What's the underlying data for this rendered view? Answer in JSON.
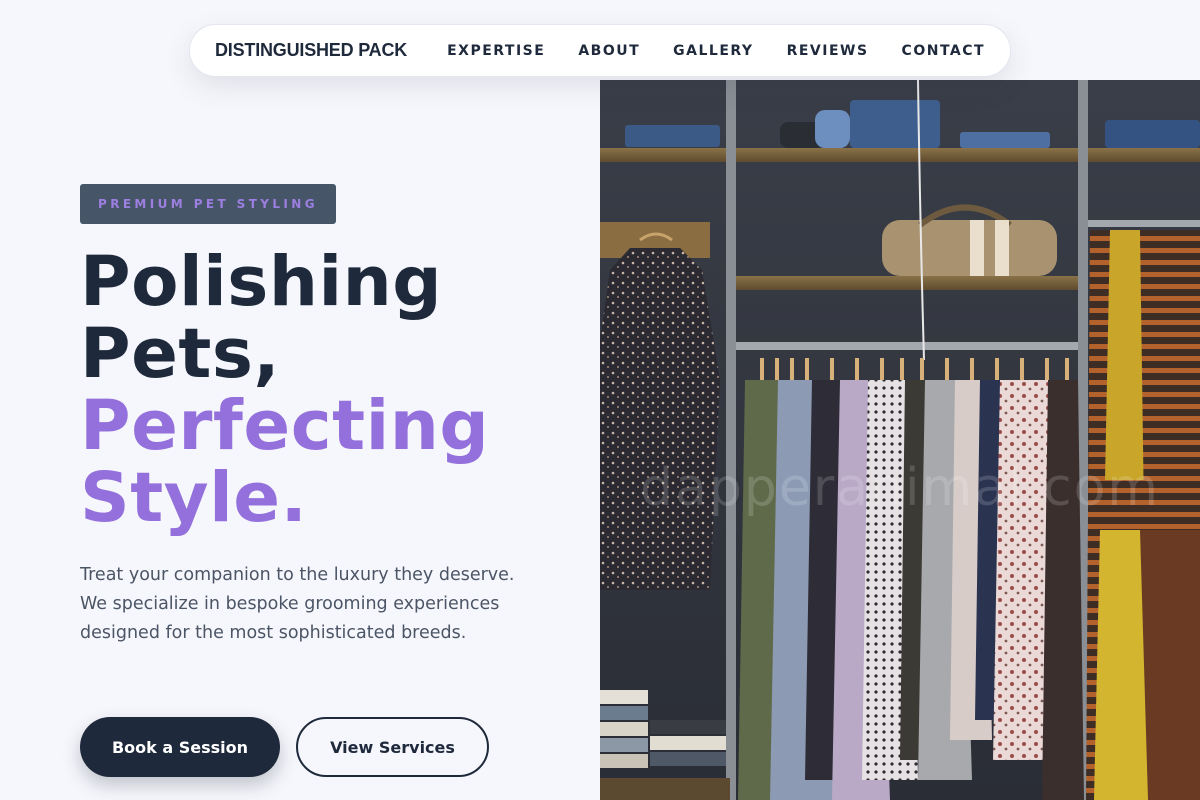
{
  "nav": {
    "brand": "DISTINGUISHED PACK",
    "links": [
      "EXPERTISE",
      "ABOUT",
      "GALLERY",
      "REVIEWS",
      "CONTACT"
    ]
  },
  "hero": {
    "badge": "PREMIUM PET STYLING",
    "headline_dark_1": "Polishing",
    "headline_dark_2": "Pets,",
    "headline_accent_1": "Perfecting",
    "headline_accent_2": "Style.",
    "description": "Treat your companion to the luxury they deserve. We specialize in bespoke grooming experiences designed for the most sophisticated breeds.",
    "primary_button": "Book a Session",
    "secondary_button": "View Services"
  },
  "image": {
    "description": "clothing rack with shelves of folded denim, a duffel bag and hanging garments",
    "watermark": "dapperanimal.com"
  },
  "colors": {
    "background": "#f6f7fc",
    "navy": "#1e293b",
    "accent": "#9370db",
    "badge_bg": "#475569"
  }
}
